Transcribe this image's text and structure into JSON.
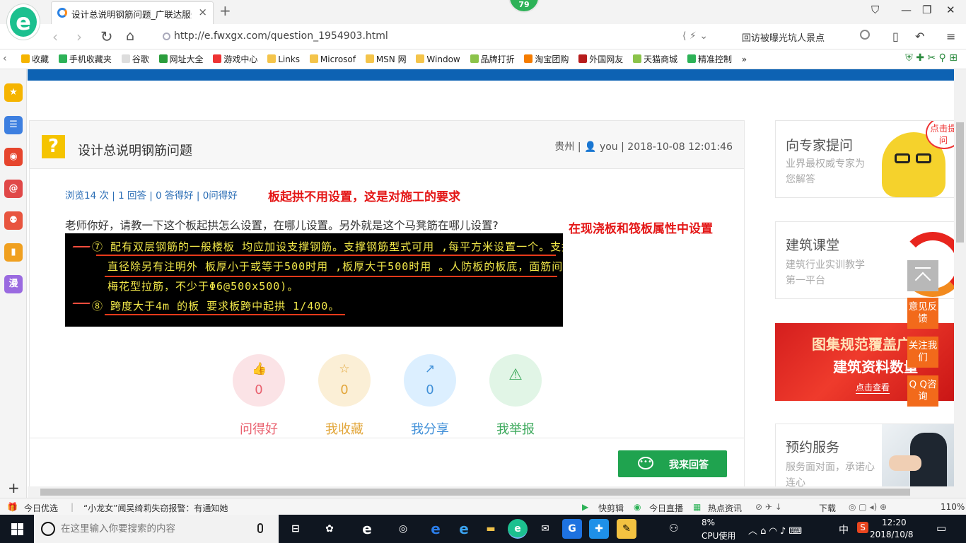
{
  "browser": {
    "tab_title": "设计总说明钢筋问题_广联达服务",
    "tab_close": "×",
    "new_tab": "+",
    "badge": "79",
    "url": "http://e.fwxgx.com/question_1954903.html",
    "search_value": "回访被曝光坑人景点"
  },
  "bookmarks": [
    "收藏",
    "手机收藏夹",
    "谷歌",
    "网址大全",
    "游戏中心",
    "Links",
    "Microsof",
    "MSN 网",
    "Window",
    "品牌打折",
    "淘宝团购",
    "外国网友",
    "天猫商城",
    "精准控制"
  ],
  "bookmarks_more": "»",
  "sidebar_icons": [
    {
      "icon": "star-icon",
      "color": "#f5b400",
      "glyph": "★"
    },
    {
      "icon": "news-icon",
      "color": "#3d7fe0",
      "glyph": "☰"
    },
    {
      "icon": "weibo-icon",
      "color": "#e6452d",
      "glyph": "◉"
    },
    {
      "icon": "mail-icon",
      "color": "#e04848",
      "glyph": "@"
    },
    {
      "icon": "game-icon",
      "color": "#e8553f",
      "glyph": "⚉"
    },
    {
      "icon": "book-icon",
      "color": "#f0a020",
      "glyph": "▮"
    },
    {
      "icon": "comic-icon",
      "color": "#9a6ae0",
      "glyph": "漫"
    }
  ],
  "question": {
    "title": "设计总说明钢筋问题",
    "region": "贵州",
    "user": "you",
    "datetime": "2018-10-08 12:01:46",
    "views": "浏览14 次",
    "answers": "1 回答",
    "good_answers": "0 答得好",
    "asked_good": "0问得好",
    "body": "老师你好，请教一下这个板起拱怎么设置，在哪儿设置。另外就是这个马凳筋在哪儿设置?",
    "annotation_1": "板起拱不用设置，这是对施工的要求",
    "annotation_2": "在现浇板和筏板属性中设置"
  },
  "cad_image": {
    "lines": [
      "⑦ 配有双层钢筋的一般楼板 均应加设支撑钢筋。支撑钢筋型式可用      ,每平方米设置一个。支撑钢筋的",
      "直径除另有注明外 板厚小于或等于500时用        ,板厚大于500时用        。人防板的板底，面筋间应设",
      "梅花型拉筋，不少于Φ6@500x500)。",
      "⑧ 跨度大于4m 的板 要求板跨中起拱 1/400。"
    ]
  },
  "actions": [
    {
      "label": "问得好",
      "count": "0",
      "icon": "thumbs-up-icon",
      "glyph": "👍",
      "bg": "#fbe3e6",
      "fg": "#e9606e"
    },
    {
      "label": "我收藏",
      "count": "0",
      "icon": "star-outline-icon",
      "glyph": "☆",
      "bg": "#fbefd6",
      "fg": "#e2a63a"
    },
    {
      "label": "我分享",
      "count": "0",
      "icon": "share-icon",
      "glyph": "↗",
      "bg": "#dcefff",
      "fg": "#3f8fd8"
    },
    {
      "label": "我举报",
      "count": "",
      "icon": "warning-icon",
      "glyph": "⚠",
      "bg": "#e1f5e6",
      "fg": "#3aa85a"
    }
  ],
  "answer_button": "我来回答",
  "right_cards": {
    "expert": {
      "title": "向专家提问",
      "sub": "业界最权威专家为您解答",
      "bubble": "点击提问"
    },
    "class": {
      "title": "建筑课堂",
      "sub": "建筑行业实训教学第一平台"
    },
    "banner": {
      "line1": "图集规范覆盖广",
      "line2": "建筑资料数量",
      "link": "点击查看"
    },
    "booking": {
      "title": "预约服务",
      "sub": "服务面对面，承诺心连心"
    }
  },
  "float_buttons": [
    "意见反馈",
    "关注我们",
    "Q Q咨询"
  ],
  "status": {
    "left": "今日优选",
    "news": "“小龙女”闻吴绮莉失窃报警：有通知她",
    "items": [
      "快剪辑",
      "今日直播",
      "热点资讯",
      "下载"
    ],
    "zoom": "110%"
  },
  "taskbar": {
    "search_placeholder": "在这里输入你要搜索的内容",
    "cpu_percent": "8%",
    "cpu_label": "CPU使用",
    "ime": "中",
    "time": "12:20",
    "date": "2018/10/8"
  }
}
